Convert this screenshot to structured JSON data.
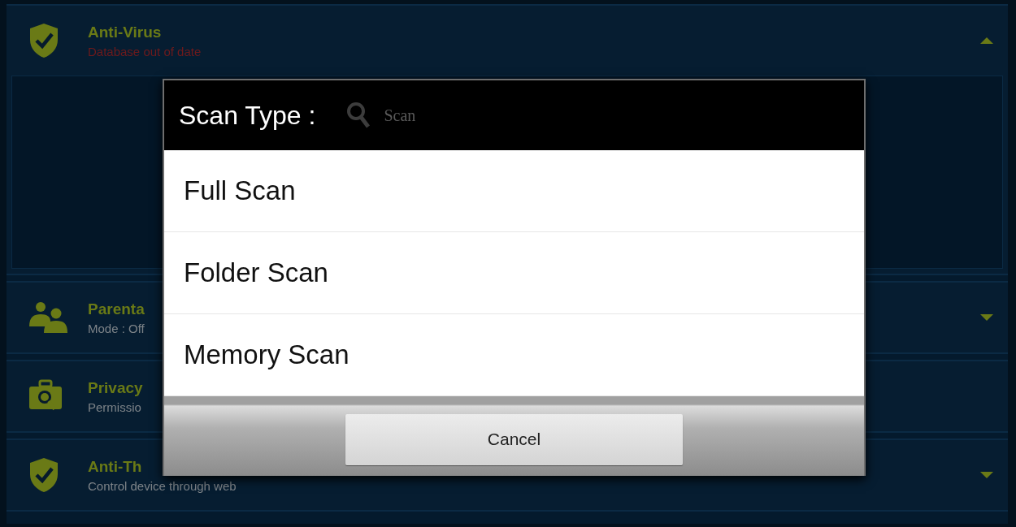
{
  "features": [
    {
      "kind": "protection",
      "title": "Anti-Virus",
      "subtitle": "Database out of date",
      "alert": true,
      "expanded": true,
      "panel_button": "Scan"
    },
    {
      "kind": "family",
      "title": "Parenta",
      "subtitle": "Mode : Off",
      "alert": false,
      "expanded": false
    },
    {
      "kind": "privacy",
      "title": "Privacy",
      "subtitle": "Permissio",
      "alert": false
    },
    {
      "kind": "protection",
      "title": "Anti-Th",
      "subtitle": "Control device through web",
      "alert": false,
      "expanded": false
    }
  ],
  "dialog": {
    "title": "Scan Type :",
    "options": [
      "Full Scan",
      "Folder Scan",
      "Memory Scan"
    ],
    "cancel": "Cancel"
  }
}
